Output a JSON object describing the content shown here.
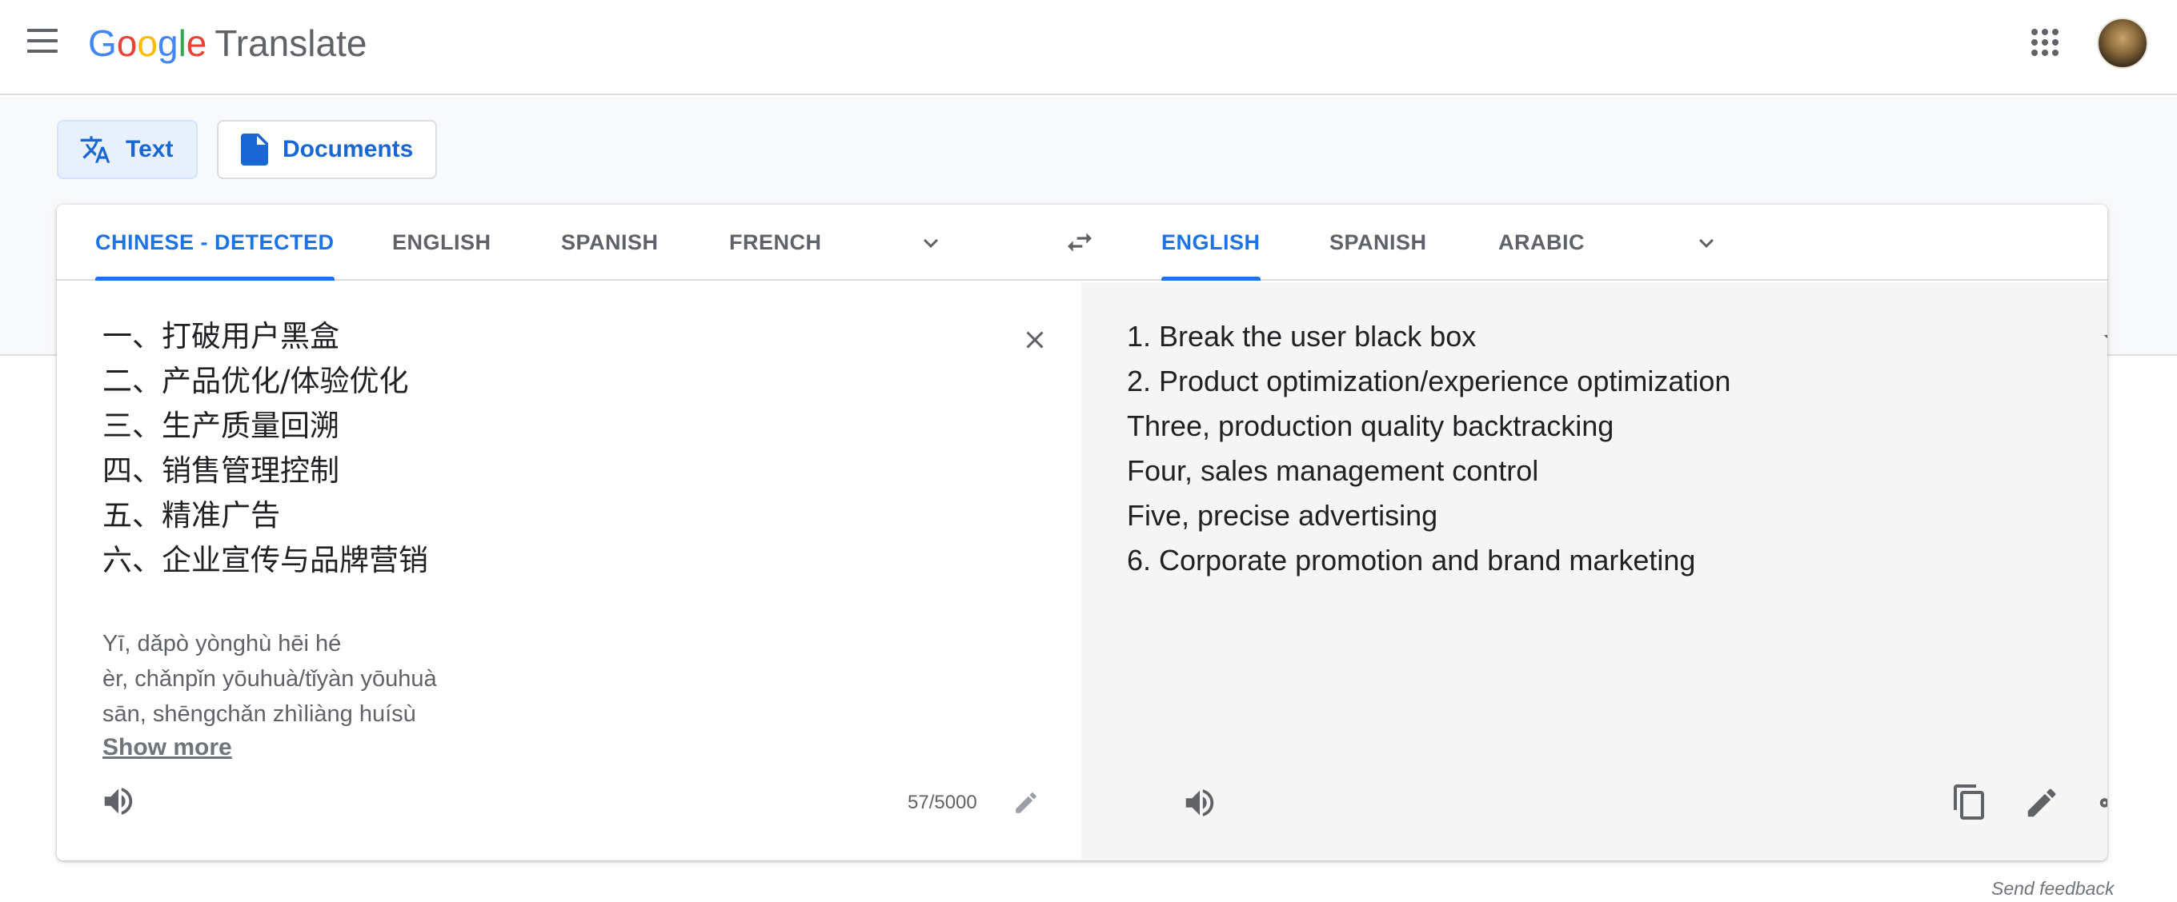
{
  "header": {
    "menu_icon": "hamburger-menu-icon",
    "logo_letters": [
      "G",
      "o",
      "o",
      "g",
      "l",
      "e"
    ],
    "product_name": "Translate",
    "apps_icon": "apps-grid-icon",
    "avatar_icon": "account-avatar"
  },
  "modes": {
    "text_label": "Text",
    "documents_label": "Documents"
  },
  "source_languages": {
    "tabs": [
      "CHINESE - DETECTED",
      "ENGLISH",
      "SPANISH",
      "FRENCH"
    ],
    "active": "CHINESE - DETECTED"
  },
  "target_languages": {
    "tabs": [
      "ENGLISH",
      "SPANISH",
      "ARABIC"
    ],
    "active": "ENGLISH"
  },
  "source": {
    "lines": [
      "一、打破用户黑盒",
      "二、产品优化/体验优化",
      "三、生产质量回溯",
      "四、销售管理控制",
      "五、精准广告",
      "六、企业宣传与品牌营销"
    ],
    "transliteration": [
      "Yī, dǎpò yònghù hēi hé",
      "èr, chǎnpǐn yōuhuà/tǐyàn yōuhuà",
      "sān, shēngchǎn zhìliàng huísù"
    ],
    "show_more": "Show more",
    "char_count": "57/5000"
  },
  "target": {
    "lines": [
      "1. Break the user black box",
      "2. Product optimization/experience optimization",
      "Three, production quality backtracking",
      "Four, sales management control",
      "Five, precise advertising",
      "6. Corporate promotion and brand marketing"
    ]
  },
  "footer": {
    "send_feedback": "Send feedback"
  },
  "colors": {
    "accent": "#1a73e8",
    "target_bg": "#f5f5f5",
    "band_bg": "#f8f9fa"
  }
}
